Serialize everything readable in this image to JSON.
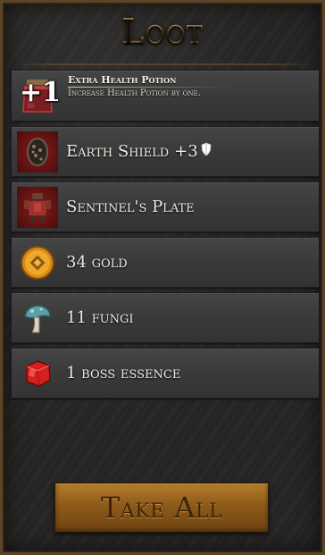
{
  "panel": {
    "title": "Loot"
  },
  "upgrade": {
    "badge": "+1",
    "title": "Extra Health Potion",
    "description": "Increase Health Potion by one.",
    "icon": "potion-bottle-icon"
  },
  "items": [
    {
      "label": "Earth Shield",
      "bonus": "+3",
      "bonus_icon": "shield-mini-icon",
      "icon": "earth-shield-icon"
    },
    {
      "label": "Sentinel's Plate",
      "icon": "armor-plate-icon"
    },
    {
      "label": "34 gold",
      "icon": "gold-coin-icon"
    },
    {
      "label": "11 fungi",
      "icon": "mushroom-icon"
    },
    {
      "label": "1 boss essence",
      "icon": "red-crystal-icon"
    }
  ],
  "button": {
    "label": "Take All"
  },
  "colors": {
    "title_gold": "#d7a24d",
    "button_bronze": "#8e5a1a",
    "row_bg": "#3a3a3a",
    "icon_red": "#6e1414"
  }
}
